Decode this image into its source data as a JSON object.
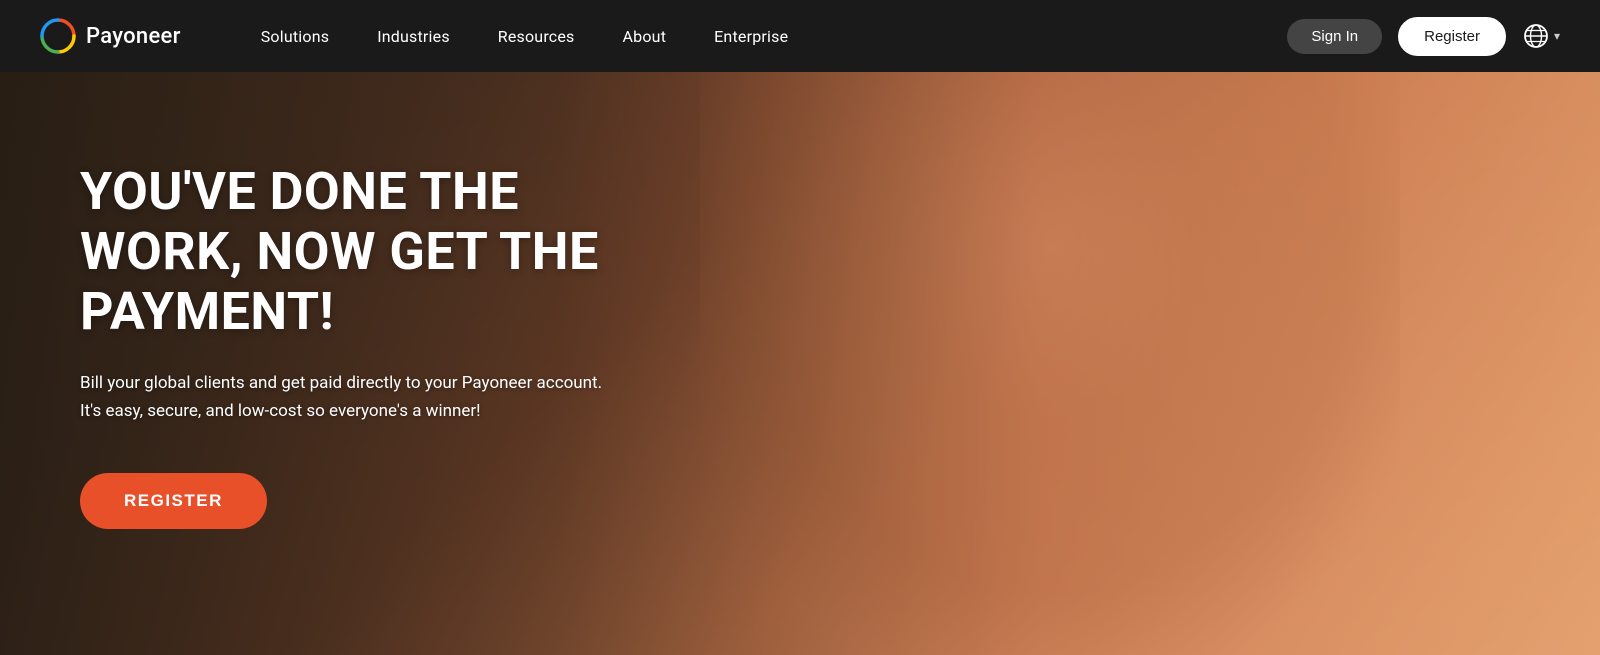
{
  "nav": {
    "logo_text": "Payoneer",
    "links": [
      {
        "label": "Solutions",
        "id": "solutions"
      },
      {
        "label": "Industries",
        "id": "industries"
      },
      {
        "label": "Resources",
        "id": "resources"
      },
      {
        "label": "About",
        "id": "about"
      },
      {
        "label": "Enterprise",
        "id": "enterprise"
      }
    ],
    "signin_label": "Sign In",
    "register_label": "Register",
    "language_chevron": "▾"
  },
  "hero": {
    "title": "YOU'VE DONE THE WORK, NOW GET THE PAYMENT!",
    "subtitle": "Bill your global clients and get paid directly to your Payoneer account.\nIt's easy, secure, and low-cost so everyone's a winner!",
    "cta_label": "REGISTER"
  },
  "colors": {
    "nav_bg": "#1a1a1a",
    "cta_bg": "#e8502a",
    "signin_bg": "#555555",
    "hero_overlay_start": "rgba(30,20,10,0.85)"
  }
}
